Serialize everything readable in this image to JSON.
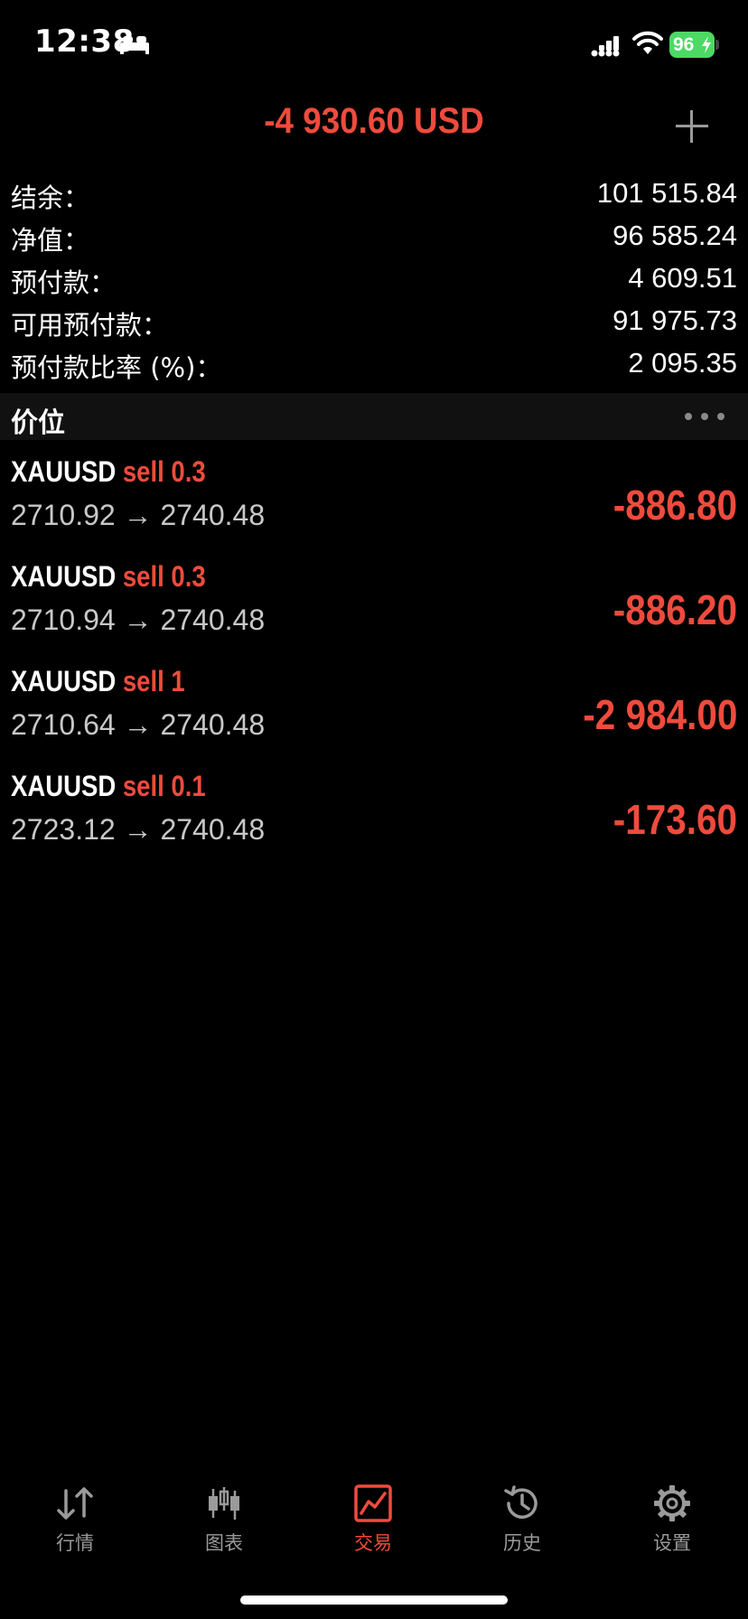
{
  "status_bar": {
    "time": "12:38",
    "battery": "96",
    "icons": [
      "bed-icon",
      "signal-icon",
      "wifi-icon",
      "battery-icon"
    ]
  },
  "header": {
    "total": "-4 930.60 USD",
    "add_icon": "plus-icon"
  },
  "summary": [
    {
      "label": "结余：",
      "value": "101 515.84"
    },
    {
      "label": "净值：",
      "value": "96 585.24"
    },
    {
      "label": "预付款：",
      "value": "4 609.51"
    },
    {
      "label": "可用预付款：",
      "value": "91 975.73"
    },
    {
      "label": "预付款比率 (%)：",
      "value": "2 095.35"
    }
  ],
  "section": {
    "title": "价位",
    "more_icon": "more-dots-icon"
  },
  "positions": [
    {
      "symbol": "XAUUSD",
      "side": "sell 0.3",
      "prices": "2710.92 → 2740.48",
      "profit": "-886.80"
    },
    {
      "symbol": "XAUUSD",
      "side": "sell 0.3",
      "prices": "2710.94 → 2740.48",
      "profit": "-886.20"
    },
    {
      "symbol": "XAUUSD",
      "side": "sell 1",
      "prices": "2710.64 → 2740.48",
      "profit": "-2 984.00"
    },
    {
      "symbol": "XAUUSD",
      "side": "sell 0.1",
      "prices": "2723.12 → 2740.48",
      "profit": "-173.60"
    }
  ],
  "tabs": [
    {
      "label": "行情",
      "icon": "quotes-icon",
      "active": false
    },
    {
      "label": "图表",
      "icon": "candlestick-chart-icon",
      "active": false
    },
    {
      "label": "交易",
      "icon": "trade-chart-icon",
      "active": true
    },
    {
      "label": "历史",
      "icon": "history-icon",
      "active": false
    },
    {
      "label": "设置",
      "icon": "settings-gear-icon",
      "active": false
    }
  ],
  "colors": {
    "background": "#000000",
    "negative": "#ef4b3d",
    "section_bg": "#111111",
    "muted_text": "#c8c8c8",
    "tab_inactive": "#9a9a9a",
    "battery": "#4cd964"
  }
}
